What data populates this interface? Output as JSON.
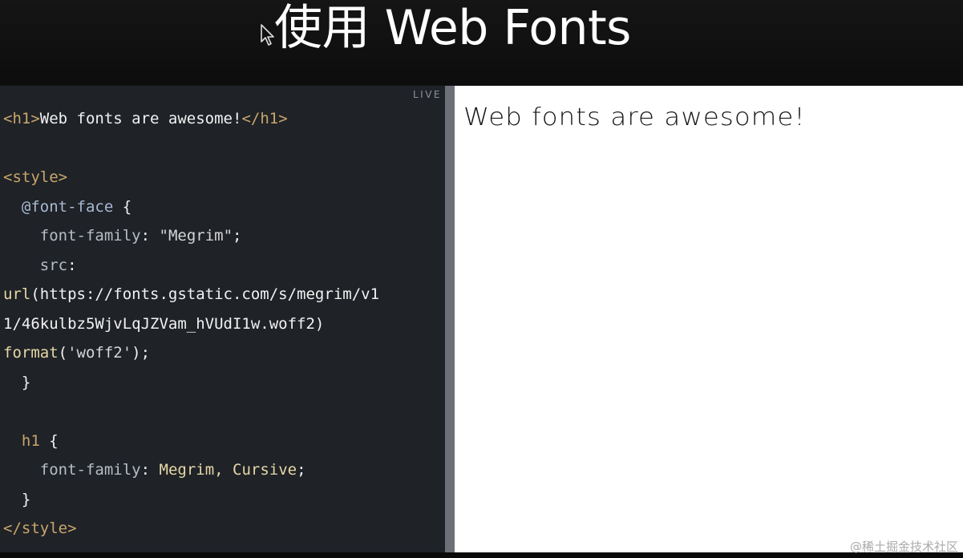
{
  "slide": {
    "title": "使用 Web Fonts"
  },
  "editor": {
    "live_label": "LIVE",
    "lines": [
      [
        {
          "t": "<h1>",
          "c": "tag"
        },
        {
          "t": "Web fonts are awesome!",
          "c": "text"
        },
        {
          "t": "</h1>",
          "c": "tag"
        }
      ],
      [],
      [
        {
          "t": "<style>",
          "c": "tag"
        }
      ],
      [
        {
          "t": "  ",
          "c": "text"
        },
        {
          "t": "@font-face",
          "c": "at"
        },
        {
          "t": " {",
          "c": "text"
        }
      ],
      [
        {
          "t": "    ",
          "c": "text"
        },
        {
          "t": "font-family",
          "c": "prop"
        },
        {
          "t": ": ",
          "c": "text"
        },
        {
          "t": "\"Megrim\"",
          "c": "str"
        },
        {
          "t": ";",
          "c": "text"
        }
      ],
      [
        {
          "t": "    ",
          "c": "text"
        },
        {
          "t": "src",
          "c": "prop"
        },
        {
          "t": ":",
          "c": "text"
        }
      ],
      [
        {
          "t": "url",
          "c": "kw"
        },
        {
          "t": "(https://fonts.gstatic.com/s/megrim/v1",
          "c": "text"
        }
      ],
      [
        {
          "t": "1/46kulbz5WjvLqJZVam_hVUdI1w.woff2)",
          "c": "text"
        }
      ],
      [
        {
          "t": "format",
          "c": "kw"
        },
        {
          "t": "(",
          "c": "text"
        },
        {
          "t": "'woff2'",
          "c": "str"
        },
        {
          "t": ");",
          "c": "text"
        }
      ],
      [
        {
          "t": "  }",
          "c": "text"
        }
      ],
      [],
      [
        {
          "t": "  ",
          "c": "text"
        },
        {
          "t": "h1",
          "c": "tag"
        },
        {
          "t": " {",
          "c": "text"
        }
      ],
      [
        {
          "t": "    ",
          "c": "text"
        },
        {
          "t": "font-family",
          "c": "prop"
        },
        {
          "t": ": ",
          "c": "text"
        },
        {
          "t": "Megrim, Cursive",
          "c": "kw"
        },
        {
          "t": ";",
          "c": "text"
        }
      ],
      [
        {
          "t": "  }",
          "c": "text"
        }
      ],
      [
        {
          "t": "</style>",
          "c": "tag"
        }
      ]
    ]
  },
  "preview": {
    "heading": "Web fonts are awesome!"
  },
  "watermark": "@稀土掘金技术社区"
}
